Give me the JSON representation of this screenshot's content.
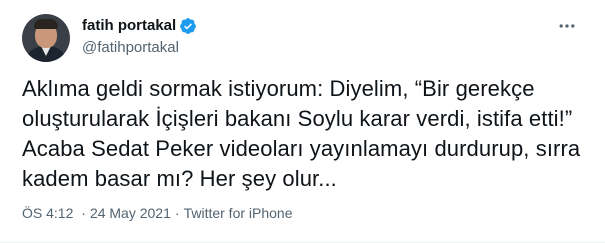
{
  "tweet": {
    "author": {
      "display_name": "fatih portakal",
      "handle": "@fatihportakal",
      "verified": true
    },
    "text_lines": [
      "Aklıma geldi sormak istiyorum: Diyelim, “Bir gerekçe",
      "oluşturularak İçişleri bakanı Soylu karar verdi, istifa etti!”",
      "Acaba Sedat Peker videoları yayınlamayı durdurup, sırra",
      "kadem basar mı? Her şey olur..."
    ],
    "meta": {
      "time": "ÖS 4:12",
      "date": "24 May 2021",
      "source": "Twitter for iPhone",
      "separator": "·"
    }
  },
  "colors": {
    "verified_blue": "#1d9bf0",
    "secondary_text": "#536471",
    "primary_text": "#0f1419"
  },
  "icons": {
    "verified": "verified-badge-icon",
    "more": "more-options-icon"
  }
}
